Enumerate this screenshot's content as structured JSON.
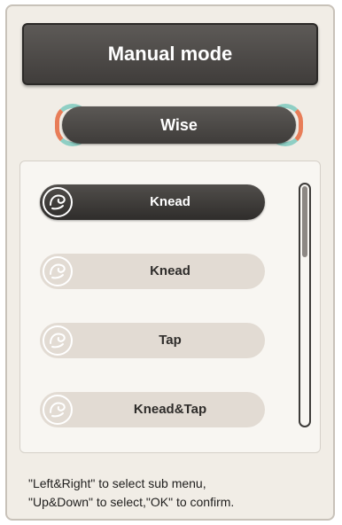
{
  "header": {
    "title": "Manual mode"
  },
  "mode": {
    "label": "Wise"
  },
  "menu": {
    "items": [
      {
        "label": "Knead",
        "icon": "massage-hand-icon",
        "state": "selected"
      },
      {
        "label": "Knead",
        "icon": "massage-hand-icon",
        "state": "disabled"
      },
      {
        "label": "Tap",
        "icon": "massage-hand-icon",
        "state": "normal"
      },
      {
        "label": "Knead&Tap",
        "icon": "massage-hand-icon",
        "state": "normal"
      }
    ],
    "scroll_fraction_visible": 0.3
  },
  "help": {
    "line1": "\"Left&Right\" to select sub menu,",
    "line2": "\"Up&Down\" to select,\"OK\" to confirm."
  },
  "colors": {
    "dark": "#3f3c3a",
    "panel": "#f1ede6",
    "pill_inactive": "#e2dbd3",
    "ring_orange": "#e87d58",
    "ring_teal": "#8fcfc4"
  }
}
